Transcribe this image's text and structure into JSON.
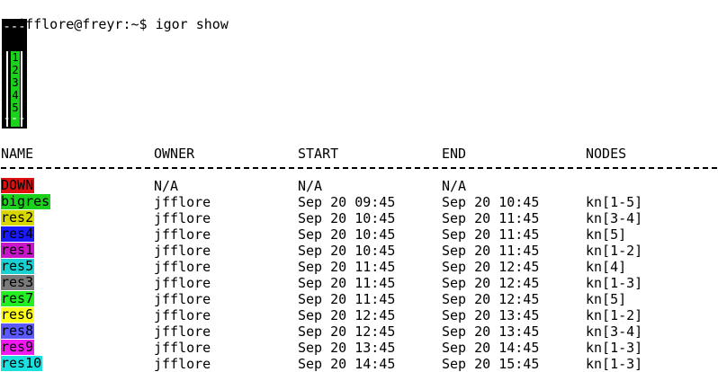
{
  "terminal": {
    "prompt": "jfflore@freyr:~$",
    "command": "igor show"
  },
  "node_map": {
    "top": "---",
    "bottom": "---",
    "nodes": [
      "1",
      "2",
      "3",
      "4",
      "5"
    ],
    "node_color": "#1bd11b"
  },
  "table": {
    "headers": {
      "name": "NAME",
      "owner": "OWNER",
      "start": "START",
      "end": "END",
      "nodes": "NODES"
    },
    "rows": [
      {
        "name": "DOWN",
        "color": "#e01010",
        "text_color": "#000000",
        "owner": "N/A",
        "start": "N/A",
        "end": "N/A",
        "nodes": ""
      },
      {
        "name": "bigres",
        "color": "#1bd11b",
        "text_color": "#000000",
        "owner": "jfflore",
        "start": "Sep 20 09:45",
        "end": "Sep 20 10:45",
        "nodes": "kn[1-5]"
      },
      {
        "name": "res2",
        "color": "#d8d800",
        "text_color": "#000000",
        "owner": "jfflore",
        "start": "Sep 20 10:45",
        "end": "Sep 20 11:45",
        "nodes": "kn[3-4]"
      },
      {
        "name": "res4",
        "color": "#1a1aff",
        "text_color": "#000000",
        "owner": "jfflore",
        "start": "Sep 20 10:45",
        "end": "Sep 20 11:45",
        "nodes": "kn[5]"
      },
      {
        "name": "res1",
        "color": "#c817c8",
        "text_color": "#000000",
        "owner": "jfflore",
        "start": "Sep 20 10:45",
        "end": "Sep 20 11:45",
        "nodes": "kn[1-2]"
      },
      {
        "name": "res5",
        "color": "#1ad0d0",
        "text_color": "#000000",
        "owner": "jfflore",
        "start": "Sep 20 11:45",
        "end": "Sep 20 12:45",
        "nodes": "kn[4]"
      },
      {
        "name": "res3",
        "color": "#7a7a7a",
        "text_color": "#000000",
        "owner": "jfflore",
        "start": "Sep 20 11:45",
        "end": "Sep 20 12:45",
        "nodes": "kn[1-3]"
      },
      {
        "name": "res7",
        "color": "#22ee22",
        "text_color": "#000000",
        "owner": "jfflore",
        "start": "Sep 20 11:45",
        "end": "Sep 20 12:45",
        "nodes": "kn[5]"
      },
      {
        "name": "res6",
        "color": "#ffff1a",
        "text_color": "#000000",
        "owner": "jfflore",
        "start": "Sep 20 12:45",
        "end": "Sep 20 13:45",
        "nodes": "kn[1-2]"
      },
      {
        "name": "res8",
        "color": "#5a5aff",
        "text_color": "#000000",
        "owner": "jfflore",
        "start": "Sep 20 12:45",
        "end": "Sep 20 13:45",
        "nodes": "kn[3-4]"
      },
      {
        "name": "res9",
        "color": "#f01af0",
        "text_color": "#000000",
        "owner": "jfflore",
        "start": "Sep 20 13:45",
        "end": "Sep 20 14:45",
        "nodes": "kn[1-3]"
      },
      {
        "name": "res10",
        "color": "#1ae0e0",
        "text_color": "#000000",
        "owner": "jfflore",
        "start": "Sep 20 14:45",
        "end": "Sep 20 15:45",
        "nodes": "kn[1-3]"
      }
    ]
  }
}
